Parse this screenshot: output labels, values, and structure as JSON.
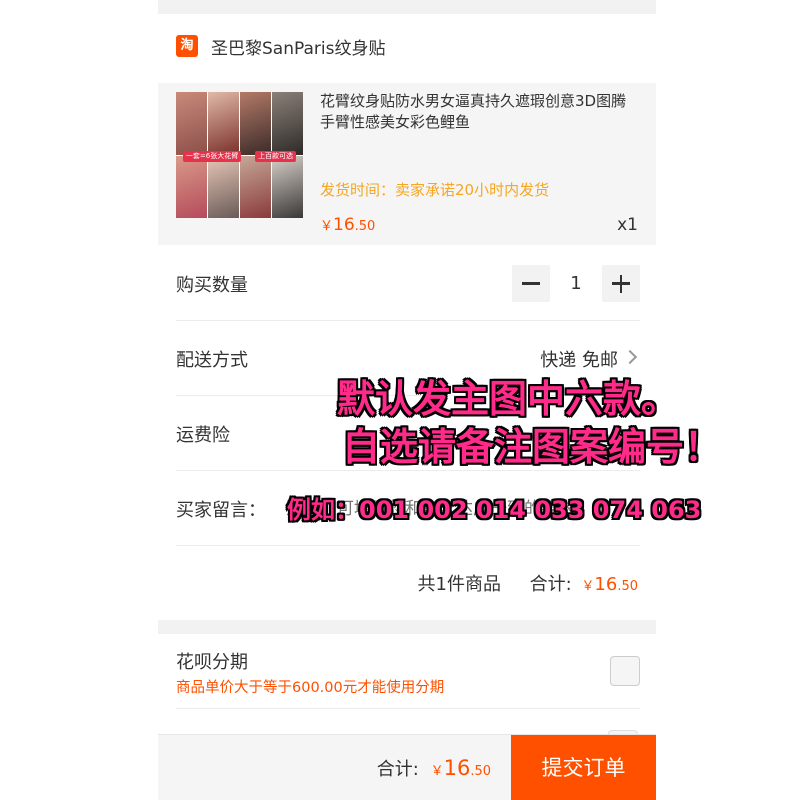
{
  "shop": {
    "logo_glyph": "淘",
    "name": "圣巴黎SanParis纹身贴"
  },
  "product": {
    "thumb_badges": [
      "一套=6张大花臂",
      "上百款可选"
    ],
    "title": "花臂纹身贴防水男女逼真持久遮瑕创意3D图腾手臂性感美女彩色鲤鱼",
    "ship_time": "发货时间：卖家承诺20小时内发货",
    "price_currency": "￥",
    "price_int": "16",
    "price_cents": ".50",
    "quantity_label": "x1"
  },
  "quantity_row": {
    "label": "购买数量",
    "value": "1"
  },
  "delivery_row": {
    "label": "配送方式",
    "value": "快递 免邮"
  },
  "insurance_row": {
    "label": "运费险"
  },
  "message_row": {
    "label": "买家留言：",
    "placeholder": "选填：可填写您和卖家达成一致的要求"
  },
  "summary": {
    "count_text": "共1件商品",
    "total_label": "合计:",
    "currency": "￥",
    "amount_int": "16",
    "amount_cents": ".50"
  },
  "installment": {
    "title": "花呗分期",
    "note": "商品单价大于等于600.00元才能使用分期",
    "checked": false
  },
  "bottom_bar": {
    "total_label": "合计:",
    "currency": "￥",
    "amount_int": "16",
    "amount_cents": ".50",
    "submit_label": "提交订单"
  },
  "overlay": {
    "line1": "默认发主图中六款。",
    "line2": "自选请备注图案编号！",
    "line3": "例如：001 002 014 033 074 063"
  },
  "colors": {
    "accent": "#ff5000",
    "ship_time": "#f5a623",
    "overlay_text": "#ff2a8a"
  }
}
